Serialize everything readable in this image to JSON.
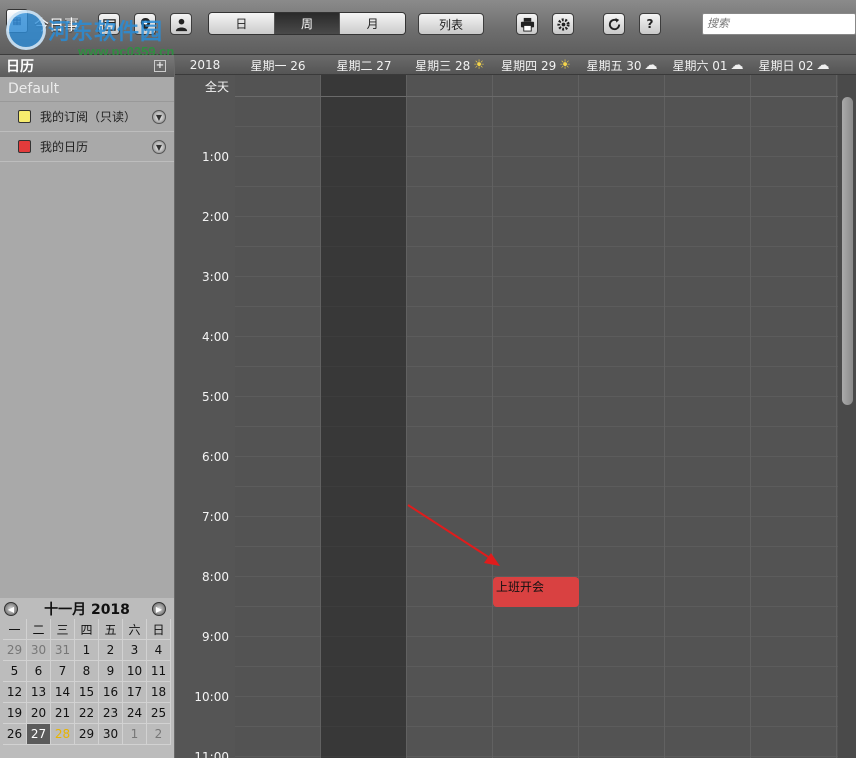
{
  "toolbar": {
    "app_title": "今日事",
    "views": [
      "日",
      "周",
      "月"
    ],
    "active_view": "周",
    "list_label": "列表",
    "help_label": "?",
    "search_placeholder": "搜索"
  },
  "watermark": {
    "title": "河东软件园",
    "url": "www.pc0359.cn"
  },
  "sidebar": {
    "title": "日历",
    "add_label": "+",
    "group": "Default",
    "calendars": [
      {
        "label": "我的订阅（只读）",
        "color": "#f7ec6e"
      },
      {
        "label": "我的日历",
        "color": "#e33b3b"
      }
    ]
  },
  "mini_calendar": {
    "title": "十一月 2018",
    "weekdays": [
      "一",
      "二",
      "三",
      "四",
      "五",
      "六",
      "日"
    ],
    "weeks": [
      [
        "29",
        "30",
        "31",
        "1",
        "2",
        "3",
        "4"
      ],
      [
        "5",
        "6",
        "7",
        "8",
        "9",
        "10",
        "11"
      ],
      [
        "12",
        "13",
        "14",
        "15",
        "16",
        "17",
        "18"
      ],
      [
        "19",
        "20",
        "21",
        "22",
        "23",
        "24",
        "25"
      ],
      [
        "26",
        "27",
        "28",
        "29",
        "30",
        "1",
        "2"
      ]
    ],
    "today": "27",
    "selected": "28"
  },
  "week": {
    "year": "2018",
    "days": [
      "星期一 26",
      "星期二 27",
      "星期三 28",
      "星期四 29",
      "星期五 30",
      "星期六 01",
      "星期日 02"
    ],
    "weather": [
      "",
      "",
      "sun",
      "sun",
      "cloud",
      "cloud",
      "cloud"
    ],
    "today_index": 1,
    "allday_label": "全天",
    "times": [
      "1:00",
      "2:00",
      "3:00",
      "4:00",
      "5:00",
      "6:00",
      "7:00",
      "8:00",
      "9:00",
      "10:00",
      "11:00"
    ]
  },
  "event": {
    "title": "上班开会",
    "color": "#d94141"
  }
}
